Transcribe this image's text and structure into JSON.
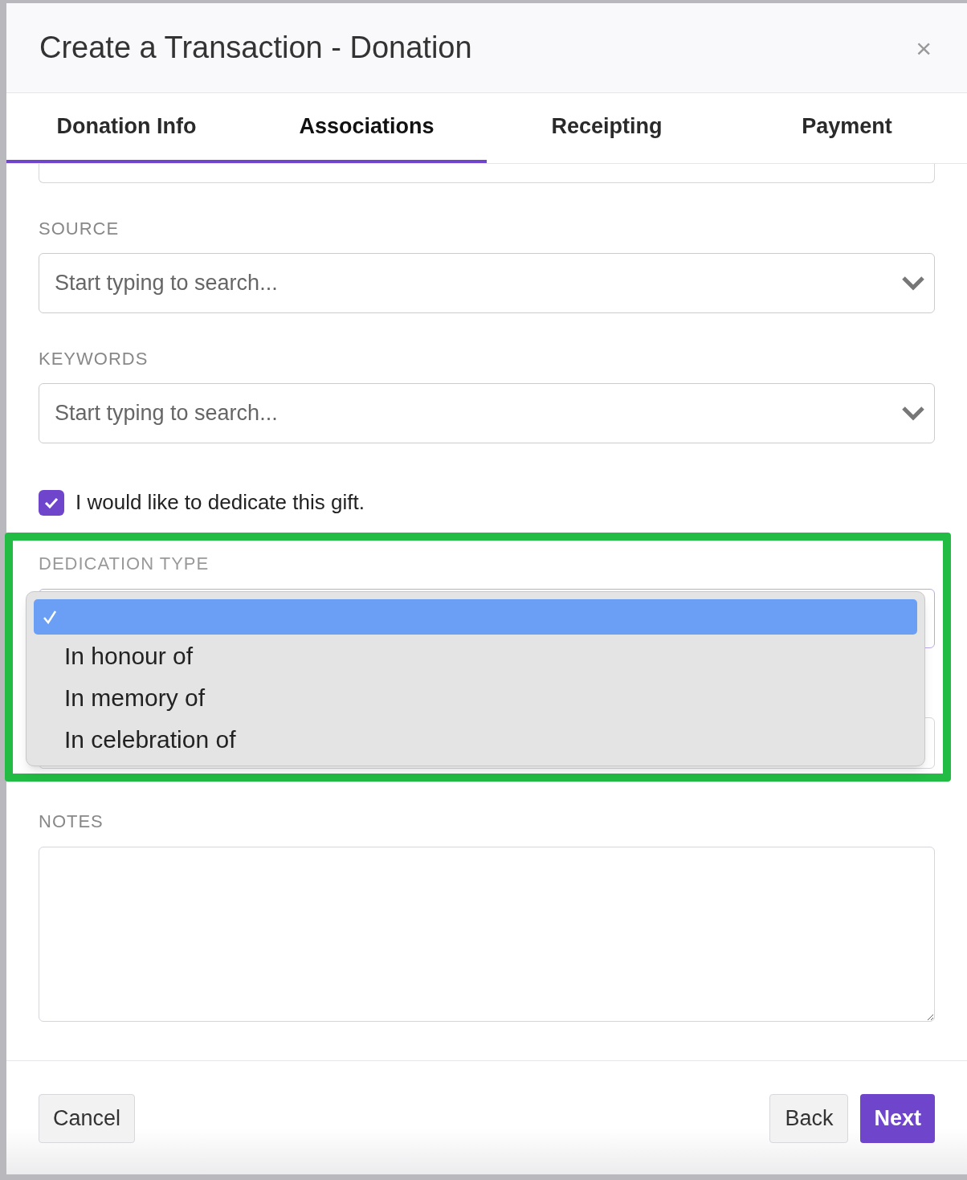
{
  "dialog": {
    "title": "Create a Transaction - Donation",
    "close": "×"
  },
  "tabs": [
    {
      "label": "Donation Info",
      "selected": false
    },
    {
      "label": "Associations",
      "selected": true
    },
    {
      "label": "Receipting",
      "selected": false
    },
    {
      "label": "Payment",
      "selected": false
    }
  ],
  "fields": [
    {
      "label": "SOURCE",
      "placeholder": "Start typing to search..."
    },
    {
      "label": "KEYWORDS",
      "placeholder": "Start typing to search..."
    }
  ],
  "dedicate": {
    "label": "I would like to dedicate this gift.",
    "checked": true
  },
  "dedication_type": {
    "label": "DEDICATION TYPE",
    "options": [
      {
        "selected": true
      },
      {
        "label": "In honour of",
        "selected": false
      },
      {
        "label": "In memory of",
        "selected": false
      },
      {
        "label": "In celebration of",
        "selected": false
      }
    ]
  },
  "notes": {
    "label": "NOTES"
  },
  "buttons": {
    "cancel": "Cancel",
    "back": "Back",
    "next": "Next"
  }
}
